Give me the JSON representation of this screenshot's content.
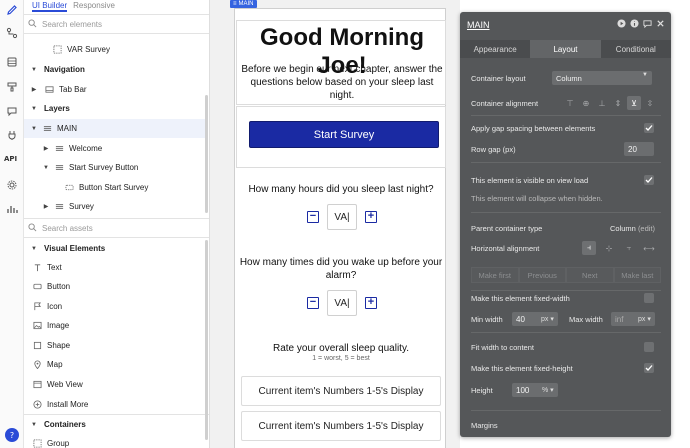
{
  "tree": {
    "tabs": [
      {
        "label": "UI Builder",
        "active": true
      },
      {
        "label": "Responsive",
        "active": false
      }
    ],
    "search_elements_placeholder": "Search elements",
    "rows": [
      {
        "label": "VAR Survey",
        "type": "group"
      },
      {
        "label": "Navigation",
        "type": "section"
      },
      {
        "label": "Tab Bar",
        "type": "item"
      },
      {
        "label": "Layers",
        "type": "section"
      },
      {
        "label": "MAIN",
        "type": "group"
      },
      {
        "label": "Welcome",
        "type": "group"
      },
      {
        "label": "Start Survey Button",
        "type": "group"
      },
      {
        "label": "Button Start Survey",
        "type": "item"
      },
      {
        "label": "Survey",
        "type": "group"
      }
    ],
    "search_assets_placeholder": "Search assets",
    "visual_elements_title": "Visual Elements",
    "visual_elements": [
      {
        "label": "Text",
        "icon": "text-icon"
      },
      {
        "label": "Button",
        "icon": "button-icon"
      },
      {
        "label": "Icon",
        "icon": "icon-icon"
      },
      {
        "label": "Image",
        "icon": "image-icon"
      },
      {
        "label": "Shape",
        "icon": "shape-icon"
      },
      {
        "label": "Map",
        "icon": "map-pin-icon"
      },
      {
        "label": "Web View",
        "icon": "web-view-icon"
      },
      {
        "label": "Install More",
        "icon": "plus-circle-icon"
      }
    ],
    "containers_title": "Containers",
    "containers": [
      {
        "label": "Group",
        "icon": "group-icon"
      }
    ]
  },
  "rail": {
    "api_label": "API"
  },
  "canvas": {
    "main_chip": "MAIN",
    "greeting": "Good Morning Joe!",
    "intro": "Before we begin our next chapter, answer the questions below based on your sleep last night.",
    "start_button": "Start Survey",
    "q1": "How many hours did you sleep last night?",
    "q1_value": "VA|",
    "q2": "How many times did you wake up before your alarm?",
    "q2_value": "VA|",
    "q3": "Rate your overall sleep quality.",
    "q3_sub": "1 = worst, 5 = best",
    "rep1": "Current item's Numbers 1-5's Display",
    "rep2": "Current item's Numbers 1-5's Display"
  },
  "props": {
    "title": "MAIN",
    "tabs": [
      {
        "label": "Appearance",
        "active": false
      },
      {
        "label": "Layout",
        "active": true
      },
      {
        "label": "Conditional",
        "active": false
      }
    ],
    "container_layout_label": "Container layout",
    "container_layout_value": "Column",
    "container_alignment_label": "Container alignment",
    "apply_gap_label": "Apply gap spacing between elements",
    "apply_gap_checked": true,
    "row_gap_label": "Row gap (px)",
    "row_gap_value": "20",
    "visible_label": "This element is visible on view load",
    "visible_checked": true,
    "collapse_note": "This element will collapse when hidden.",
    "parent_type_label": "Parent container type",
    "parent_type_value": "Column",
    "parent_type_edit": "(edit)",
    "horizontal_alignment_label": "Horizontal alignment",
    "order": [
      "Make first",
      "Previous",
      "Next",
      "Make last"
    ],
    "fixed_width_label": "Make this element fixed-width",
    "fixed_width_checked": false,
    "min_width_label": "Min width",
    "min_width_value": "40",
    "min_width_unit": "px",
    "max_width_label": "Max width",
    "max_width_value": "inf",
    "max_width_unit": "px",
    "fit_width_label": "Fit width to content",
    "fit_width_checked": false,
    "fixed_height_label": "Make this element fixed-height",
    "fixed_height_checked": true,
    "height_label": "Height",
    "height_value": "100",
    "height_unit": "%",
    "margins_label": "Margins"
  }
}
